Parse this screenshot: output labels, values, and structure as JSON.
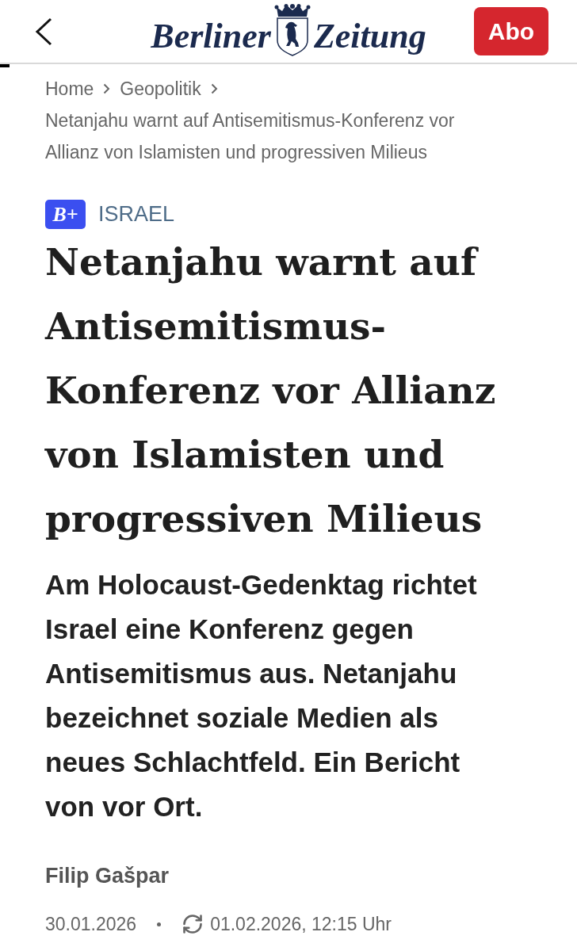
{
  "header": {
    "logo": [
      "Berliner",
      "Zeitung"
    ],
    "subscribe_button": "Abo"
  },
  "reading_progress": {
    "level": 0.017
  },
  "breadcrumb": {
    "items": [
      "Home",
      "Geopolitik"
    ],
    "current": "Netanjahu warnt auf Antisemitismus-Konferenz vor Allianz von Islamisten und progressiven Milieus"
  },
  "article": {
    "badge": "B+",
    "category": "ISRAEL",
    "headline": "Netanjahu warnt auf Antisemitismus-Konferenz vor Allianz von Islamisten und progressiven Milieus",
    "teaser": "Am Holocaust-Gedenktag richtet Israel eine Konferenz gegen Antisemitismus aus. Netanjahu bezeichnet soziale Medien als neues Schlachtfeld. Ein Bericht von vor Ort.",
    "author": "Filip Gašpar",
    "published": "30.01.2026",
    "updated": "01.02.2026, 12:15 Uhr"
  }
}
